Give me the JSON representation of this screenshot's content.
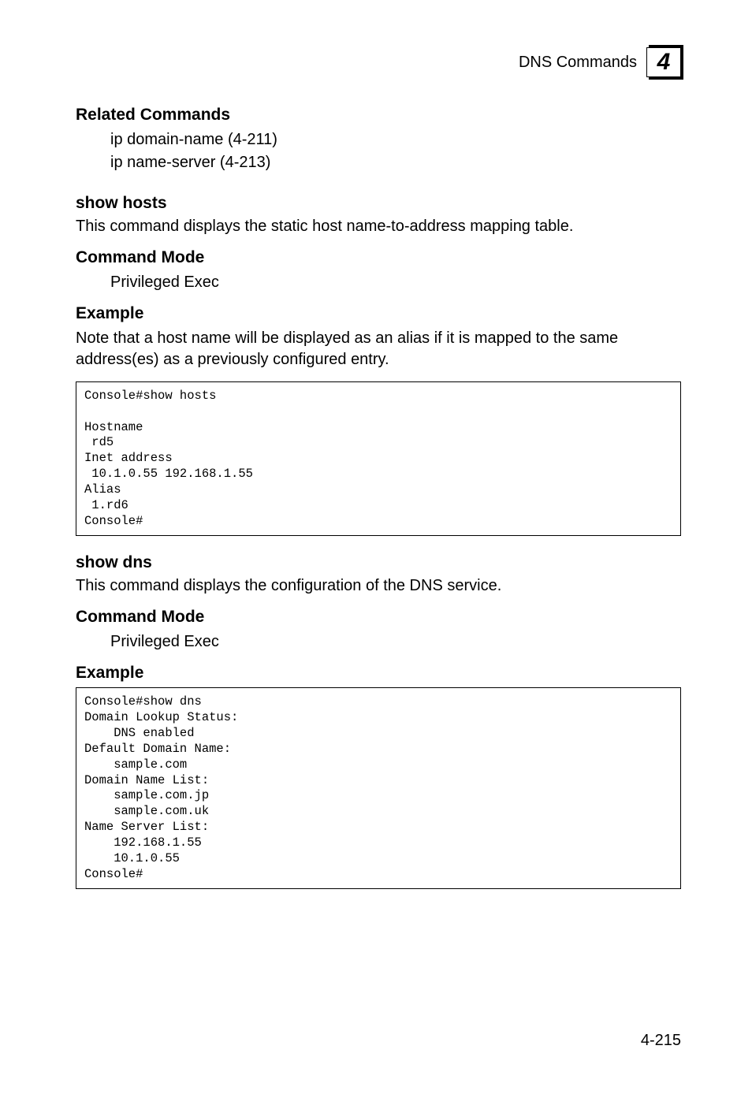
{
  "header": {
    "title": "DNS Commands",
    "chapter": "4"
  },
  "relatedCommands": {
    "heading": "Related Commands",
    "items": [
      "ip domain-name (4-211)",
      "ip name-server (4-213)"
    ]
  },
  "showHosts": {
    "heading": "show hosts",
    "desc": "This command displays the static host name-to-address mapping table.",
    "cmdModeHeading": "Command Mode",
    "cmdMode": "Privileged Exec",
    "exampleHeading": "Example",
    "note": "Note that a host name will be displayed as an alias if it is mapped to the same address(es) as a previously configured entry.",
    "code": "Console#show hosts\n\nHostname\n rd5\nInet address\n 10.1.0.55 192.168.1.55\nAlias\n 1.rd6\nConsole#"
  },
  "showDns": {
    "heading": "show dns",
    "desc": "This command displays the configuration of the DNS service.",
    "cmdModeHeading": "Command Mode",
    "cmdMode": "Privileged Exec",
    "exampleHeading": "Example",
    "code": "Console#show dns\nDomain Lookup Status:\n    DNS enabled\nDefault Domain Name:\n    sample.com\nDomain Name List:\n    sample.com.jp\n    sample.com.uk\nName Server List:\n    192.168.1.55\n    10.1.0.55\nConsole#"
  },
  "pageNumber": "4-215"
}
